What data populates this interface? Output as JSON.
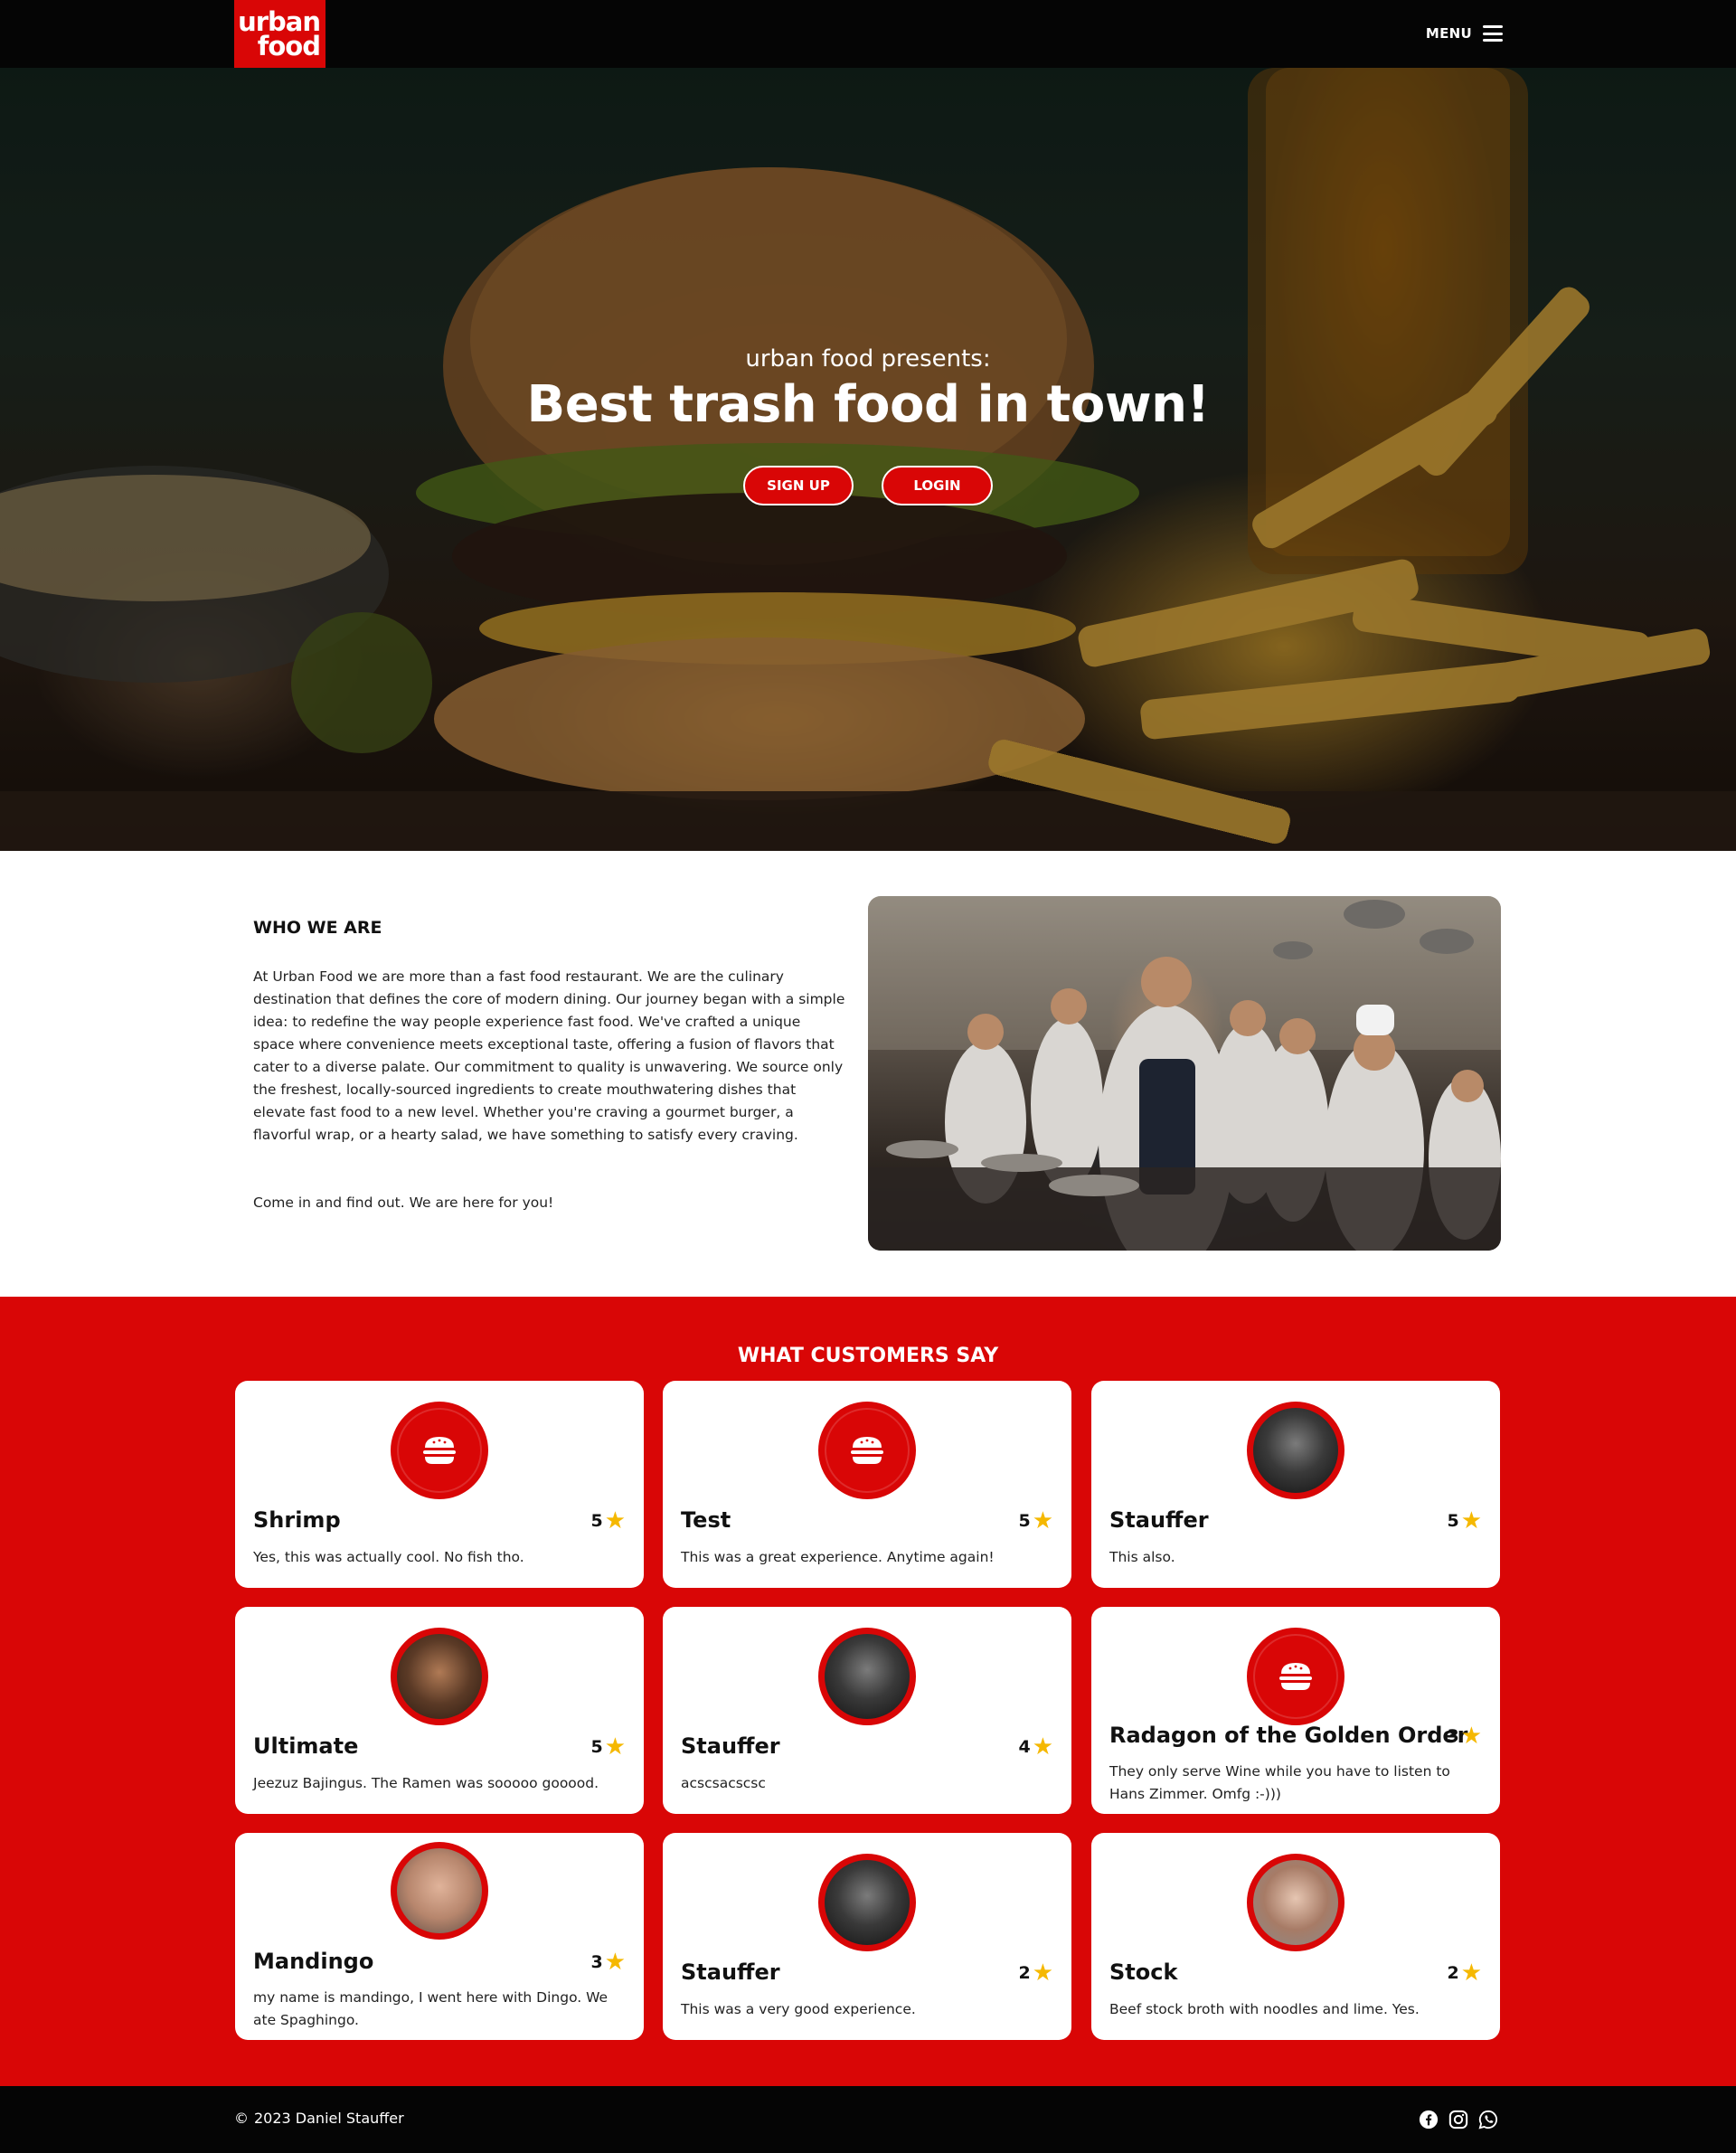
{
  "nav": {
    "logo_line1": "urban",
    "logo_line2": "food",
    "menu_label": "MENU"
  },
  "hero": {
    "subtitle": "urban food presents:",
    "title": "Best trash food in town!",
    "signup_label": "SIGN UP",
    "login_label": "LOGIN"
  },
  "about": {
    "title": "WHO WE ARE",
    "paragraph1": "At Urban Food we are more than a fast food restaurant. We are the culinary destination that defines the core of modern dining. Our journey began with a simple idea: to redefine the way people experience fast food. We've crafted a unique space where convenience meets exceptional taste, offering a fusion of flavors that cater to a diverse palate. Our commitment to quality is unwavering. We source only the freshest, locally-sourced ingredients to create mouthwatering dishes that elevate fast food to a new level. Whether you're craving a gourmet burger, a flavorful wrap, or a hearty salad, we have something to satisfy every craving.",
    "paragraph2": "Come in and find out. We are here for you!"
  },
  "reviews": {
    "title": "WHAT CUSTOMERS SAY",
    "items": [
      {
        "name": "Shrimp",
        "rating": "5",
        "text": "Yes, this was actually cool. No fish tho.",
        "avatar": "burger-icon"
      },
      {
        "name": "Test",
        "rating": "5",
        "text": "This was a great experience. Anytime again!",
        "avatar": "burger-icon"
      },
      {
        "name": "Stauffer",
        "rating": "5",
        "text": "This also.",
        "avatar": "user-photo"
      },
      {
        "name": "Ultimate",
        "rating": "5",
        "text": "Jeezuz Bajingus. The Ramen was sooooo gooood.",
        "avatar": "user-photo"
      },
      {
        "name": "Stauffer",
        "rating": "4",
        "text": "acscsacscsc",
        "avatar": "user-photo"
      },
      {
        "name": "Radagon of the Golden Order",
        "rating": "3",
        "text": "They only serve Wine while you have to listen to Hans Zimmer. Omfg :-)))",
        "avatar": "burger-icon"
      },
      {
        "name": "Mandingo",
        "rating": "3",
        "text": "my name is mandingo, I went here with Dingo. We ate Spaghingo.",
        "avatar": "user-photo"
      },
      {
        "name": "Stauffer",
        "rating": "2",
        "text": "This was a very good experience.",
        "avatar": "user-photo"
      },
      {
        "name": "Stock",
        "rating": "2",
        "text": "Beef stock broth with noodles and lime. Yes.",
        "avatar": "user-photo"
      }
    ]
  },
  "footer": {
    "copyright": "2023 Daniel Stauffer",
    "social": [
      "facebook-icon",
      "instagram-icon",
      "whatsapp-icon"
    ]
  },
  "colors": {
    "brand_red": "#d90606",
    "black": "#050505",
    "star": "#f5b800"
  }
}
